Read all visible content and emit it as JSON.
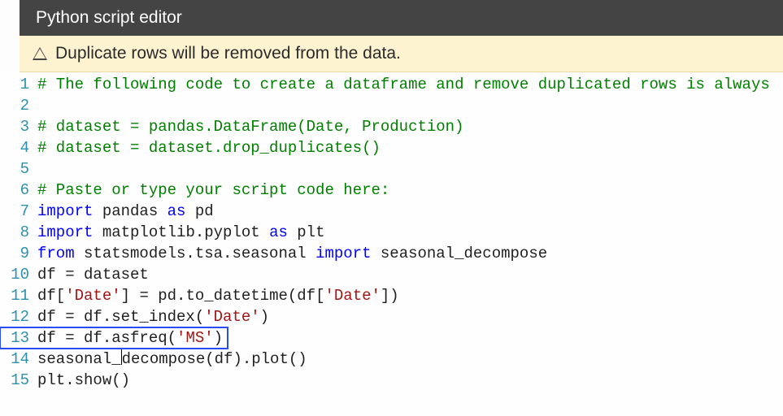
{
  "header": {
    "title": "Python script editor"
  },
  "warning": {
    "text": "Duplicate rows will be removed from the data."
  },
  "editor": {
    "highlighted_line": 13,
    "cursor_line": 14,
    "lines": [
      {
        "n": 1,
        "tokens": [
          {
            "cls": "c-comment",
            "t": "# The following code to create a dataframe and remove duplicated rows is always"
          }
        ]
      },
      {
        "n": 2,
        "tokens": [
          {
            "cls": "c-plain",
            "t": ""
          }
        ]
      },
      {
        "n": 3,
        "tokens": [
          {
            "cls": "c-comment",
            "t": "# dataset = pandas.DataFrame(Date, Production)"
          }
        ]
      },
      {
        "n": 4,
        "tokens": [
          {
            "cls": "c-comment",
            "t": "# dataset = dataset.drop_duplicates()"
          }
        ]
      },
      {
        "n": 5,
        "tokens": [
          {
            "cls": "c-plain",
            "t": ""
          }
        ]
      },
      {
        "n": 6,
        "tokens": [
          {
            "cls": "c-comment",
            "t": "# Paste or type your script code here:"
          }
        ]
      },
      {
        "n": 7,
        "tokens": [
          {
            "cls": "c-keyword",
            "t": "import"
          },
          {
            "cls": "c-plain",
            "t": " pandas "
          },
          {
            "cls": "c-keyword",
            "t": "as"
          },
          {
            "cls": "c-plain",
            "t": " pd"
          }
        ]
      },
      {
        "n": 8,
        "tokens": [
          {
            "cls": "c-keyword",
            "t": "import"
          },
          {
            "cls": "c-plain",
            "t": " matplotlib.pyplot "
          },
          {
            "cls": "c-keyword",
            "t": "as"
          },
          {
            "cls": "c-plain",
            "t": " plt"
          }
        ]
      },
      {
        "n": 9,
        "tokens": [
          {
            "cls": "c-keyword",
            "t": "from"
          },
          {
            "cls": "c-plain",
            "t": " statsmodels.tsa.seasonal "
          },
          {
            "cls": "c-keyword",
            "t": "import"
          },
          {
            "cls": "c-plain",
            "t": " seasonal_decompose"
          }
        ]
      },
      {
        "n": 10,
        "tokens": [
          {
            "cls": "c-plain",
            "t": "df = dataset"
          }
        ]
      },
      {
        "n": 11,
        "tokens": [
          {
            "cls": "c-plain",
            "t": "df["
          },
          {
            "cls": "c-string",
            "t": "'Date'"
          },
          {
            "cls": "c-plain",
            "t": "] = pd.to_datetime(df["
          },
          {
            "cls": "c-string",
            "t": "'Date'"
          },
          {
            "cls": "c-plain",
            "t": "])"
          }
        ]
      },
      {
        "n": 12,
        "tokens": [
          {
            "cls": "c-plain",
            "t": "df = df.set_index("
          },
          {
            "cls": "c-string",
            "t": "'Date'"
          },
          {
            "cls": "c-plain",
            "t": ")"
          }
        ]
      },
      {
        "n": 13,
        "tokens": [
          {
            "cls": "c-plain",
            "t": "df = df.asfreq("
          },
          {
            "cls": "c-string",
            "t": "'"
          },
          {
            "cls": "c-string sel",
            "t": "MS"
          },
          {
            "cls": "c-string",
            "t": "'"
          },
          {
            "cls": "c-plain",
            "t": ")"
          }
        ]
      },
      {
        "n": 14,
        "tokens": [
          {
            "cls": "c-plain",
            "t": "seasonal_"
          },
          {
            "cls": "caret-marker",
            "t": ""
          },
          {
            "cls": "c-plain",
            "t": "decompose(df).plot()"
          }
        ]
      },
      {
        "n": 15,
        "tokens": [
          {
            "cls": "c-plain",
            "t": "plt.show()"
          }
        ]
      }
    ]
  }
}
